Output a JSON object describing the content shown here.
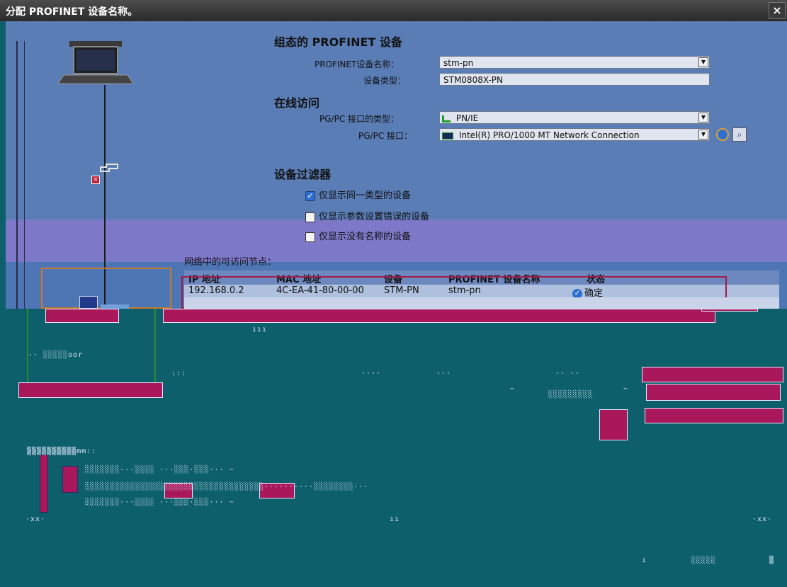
{
  "window": {
    "title": "分配 PROFINET 设备名称。",
    "close_glyph": "×"
  },
  "configured": {
    "heading": "组态的 PROFINET 设备",
    "name_label": "PROFINET设备名称：",
    "name_value": "stm-pn",
    "type_label": "设备类型：",
    "type_value": "STM0808X-PN"
  },
  "online": {
    "heading": "在线访问",
    "iface_type_label": "PG/PC 接口的类型：",
    "iface_type_value": "PN/IE",
    "iface_label": "PG/PC 接口：",
    "iface_value": "Intel(R) PRO/1000 MT Network Connection"
  },
  "filter": {
    "heading": "设备过滤器",
    "options": [
      {
        "label": "仅显示同一类型的设备",
        "checked": true
      },
      {
        "label": "仅显示参数设置错误的设备",
        "checked": false
      },
      {
        "label": "仅显示没有名称的设备",
        "checked": false
      }
    ]
  },
  "nodes": {
    "heading": "网络中的可访问节点：",
    "columns": [
      "IP 地址",
      "MAC 地址",
      "设备",
      "PROFINET 设备名称",
      "状态"
    ],
    "rows": [
      {
        "ip": "192.168.0.2",
        "mac": "4C-EA-41-80-00-00",
        "device": "STM-PN",
        "name": "stm-pn",
        "status": "确定"
      }
    ]
  },
  "colors": {
    "accent": "#2f6fd1",
    "selection": "#a01d4a",
    "status_ok": "#2f6fd1"
  }
}
